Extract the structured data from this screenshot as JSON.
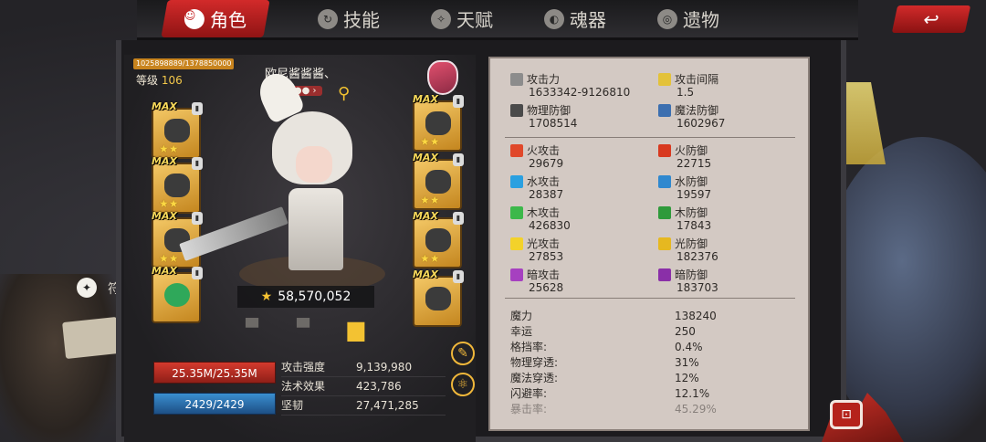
{
  "tabs": [
    {
      "label": "角色",
      "icon": "face-icon",
      "active": true
    },
    {
      "label": "技能",
      "icon": "skill-swirl-icon",
      "active": false
    },
    {
      "label": "天赋",
      "icon": "talent-icon",
      "active": false
    },
    {
      "label": "魂器",
      "icon": "soul-icon",
      "active": false
    },
    {
      "label": "遗物",
      "icon": "relic-icon",
      "active": false
    }
  ],
  "hero": {
    "xp_text": "1025898889/1378850000",
    "level_label": "等级",
    "level_value": "106",
    "name": "欧尼酱酱酱、",
    "power": "58,570,052"
  },
  "equipment": {
    "max_label": "MAX",
    "stars": "★★",
    "lock_icon": "lock-icon"
  },
  "bars": {
    "hp": "25.35M/25.35M",
    "mp": "2429/2429"
  },
  "mini_stats": [
    {
      "label": "攻击强度",
      "value": "9,139,980"
    },
    {
      "label": "法术效果",
      "value": "423,786"
    },
    {
      "label": "坚韧",
      "value": "27,471,285"
    }
  ],
  "stats_top": [
    {
      "label": "攻击力",
      "value": "1633342-9126810",
      "color": "#8c8c8c"
    },
    {
      "label": "攻击间隔",
      "value": "1.5",
      "color": "#e3c23a"
    },
    {
      "label": "物理防御",
      "value": "1708514",
      "color": "#4a4a4a"
    },
    {
      "label": "魔法防御",
      "value": "1602967",
      "color": "#3c6fb0"
    }
  ],
  "stats_elem": [
    {
      "label": "火攻击",
      "value": "29679",
      "color": "#e0482a"
    },
    {
      "label": "火防御",
      "value": "22715",
      "color": "#d8391f"
    },
    {
      "label": "水攻击",
      "value": "28387",
      "color": "#2aa0e0"
    },
    {
      "label": "水防御",
      "value": "19597",
      "color": "#2f88cf"
    },
    {
      "label": "木攻击",
      "value": "426830",
      "color": "#3cb84a"
    },
    {
      "label": "木防御",
      "value": "17843",
      "color": "#2f9a3b"
    },
    {
      "label": "光攻击",
      "value": "27853",
      "color": "#f3d22a"
    },
    {
      "label": "光防御",
      "value": "182376",
      "color": "#e6b820"
    },
    {
      "label": "暗攻击",
      "value": "25628",
      "color": "#a640c0"
    },
    {
      "label": "暗防御",
      "value": "183703",
      "color": "#8a2fa8"
    }
  ],
  "stats_list": [
    {
      "label": "魔力",
      "value": "138240"
    },
    {
      "label": "幸运",
      "value": "250"
    },
    {
      "label": "格挡率:",
      "value": "0.4%"
    },
    {
      "label": "物理穿透:",
      "value": "31%"
    },
    {
      "label": "魔法穿透:",
      "value": "12%"
    },
    {
      "label": "闪避率:",
      "value": "12.1%"
    },
    {
      "label": "暴击率:",
      "value": "45.29%"
    }
  ],
  "side_label": "符"
}
